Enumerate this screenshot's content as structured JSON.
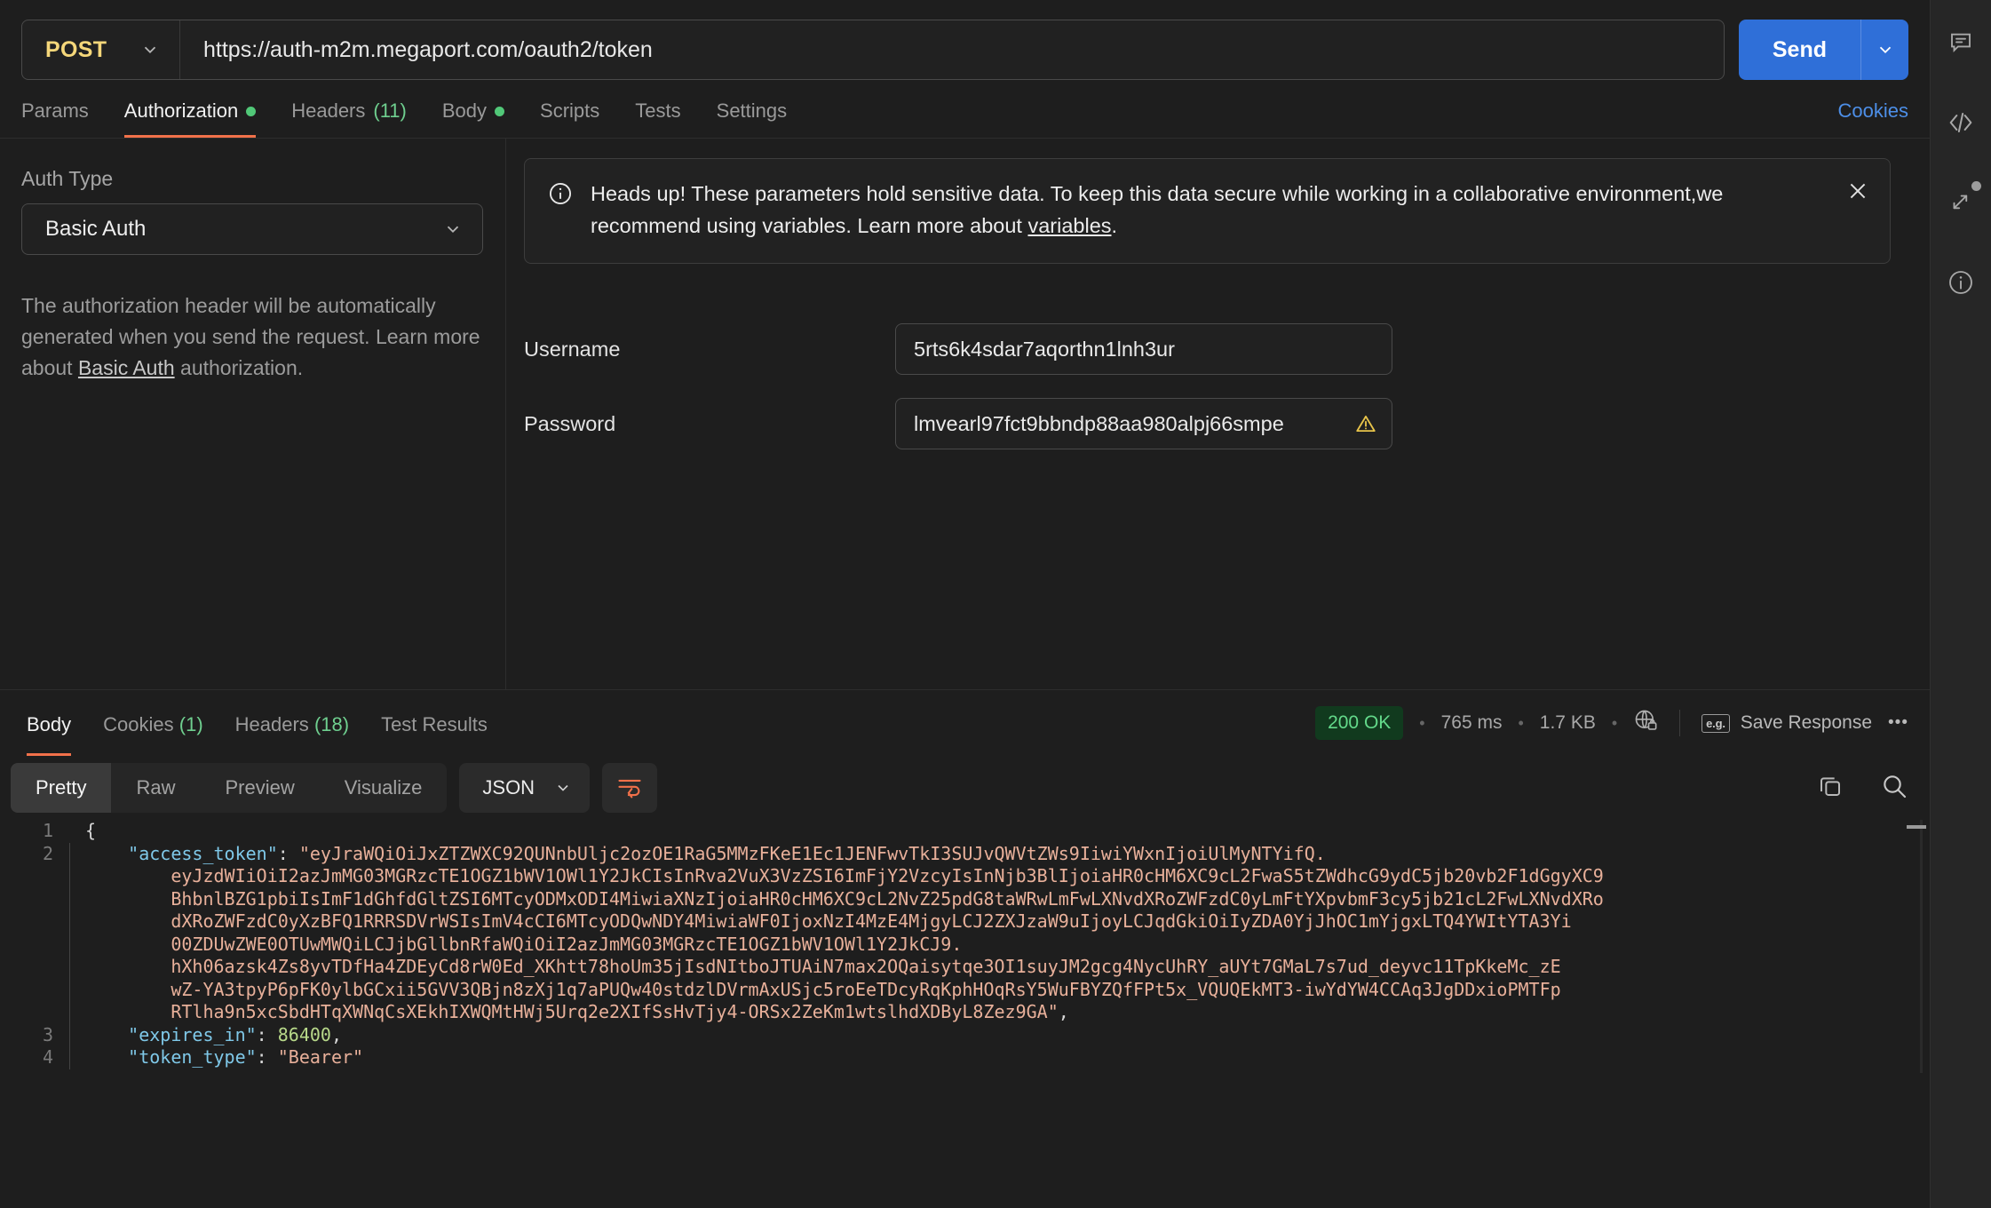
{
  "request": {
    "method": "POST",
    "url": "https://auth-m2m.megaport.com/oauth2/token",
    "send_label": "Send",
    "cookies_label": "Cookies",
    "tabs": [
      {
        "label": "Params",
        "badge": "",
        "dot": false
      },
      {
        "label": "Authorization",
        "badge": "",
        "dot": true
      },
      {
        "label": "Headers",
        "badge": "(11)",
        "dot": false
      },
      {
        "label": "Body",
        "badge": "",
        "dot": true
      },
      {
        "label": "Scripts",
        "badge": "",
        "dot": false
      },
      {
        "label": "Tests",
        "badge": "",
        "dot": false
      },
      {
        "label": "Settings",
        "badge": "",
        "dot": false
      }
    ]
  },
  "auth": {
    "type_label": "Auth Type",
    "type_value": "Basic Auth",
    "help_text_1": "The authorization header will be automatically generated when you send the request. Learn more about ",
    "help_link": "Basic Auth",
    "help_text_2": " authorization.",
    "notice_text_1": "Heads up! These parameters hold sensitive data. To keep this data secure while working in a collaborative environment,we recommend using variables. Learn more about ",
    "notice_link": "variables",
    "notice_text_2": ".",
    "username_label": "Username",
    "username_value": "5rts6k4sdar7aqorthn1lnh3ur",
    "username_placeholder": "Username",
    "password_label": "Password",
    "password_value": "lmvearl97fct9bbndp88aa980alpj66smpe",
    "password_placeholder": "Password"
  },
  "response": {
    "tabs": [
      {
        "label": "Body",
        "badge": ""
      },
      {
        "label": "Cookies",
        "badge": "(1)"
      },
      {
        "label": "Headers",
        "badge": "(18)"
      },
      {
        "label": "Test Results",
        "badge": ""
      }
    ],
    "status": "200 OK",
    "time": "765 ms",
    "size": "1.7 KB",
    "save_label": "Save Response",
    "kebab": "•••",
    "format_tabs": [
      "Pretty",
      "Raw",
      "Preview",
      "Visualize"
    ],
    "format_active": "Pretty",
    "language": "JSON"
  },
  "body_json": {
    "lines": [
      {
        "no": "1",
        "segments": [
          {
            "t": "{",
            "c": "p"
          }
        ]
      },
      {
        "no": "2",
        "segments": [
          {
            "t": "    ",
            "c": "p"
          },
          {
            "t": "\"access_token\"",
            "c": "k"
          },
          {
            "t": ": ",
            "c": "p"
          },
          {
            "t": "\"eyJraWQiOiJxZTZWXC92QUNnbUljc2ozOE1RaG5MMzFKeE1Ec1JENFwvTkI3SUJvQWVtZWs9IiwiYWxnIjoiUlMyNTYifQ.",
            "c": "s"
          }
        ]
      },
      {
        "no": "",
        "segments": [
          {
            "t": "        ",
            "c": "p"
          },
          {
            "t": "eyJzdWIiOiI2azJmMG03MGRzcTE1OGZ1bWV1OWl1Y2JkCIsInRva2VuX3VzZSI6ImFjY2VzcyIsInNjb3BlIjoiaHR0cHM6XC9cL2FwaS5tZWdhcG9ydC5jb20vb2F1dGgyXC9",
            "c": "s"
          }
        ]
      },
      {
        "no": "",
        "segments": [
          {
            "t": "        ",
            "c": "p"
          },
          {
            "t": "BhbnlBZG1pbiIsImF1dGhfdGltZSI6MTcyODMxODI4MiwiaXNzIjoiaHR0cHM6XC9cL2NvZ25pdG8taWRwLmFwLXNvdXRoZWFzdC0yLmFtYXpvbmF3cy5jb21cL2FwLXNvdXRo",
            "c": "s"
          }
        ]
      },
      {
        "no": "",
        "segments": [
          {
            "t": "        ",
            "c": "p"
          },
          {
            "t": "dXRoZWFzdC0yXzBFQ1RRRSDVrWSIsImV4cCI6MTcyODQwNDY4MiwiaWF0IjoxNzI4MzE4MjgyLCJ2ZXJzaW9uIjoyLCJqdGkiOiIyZDA0YjJhOC1mYjgxLTQ4YWItYTA3Yi",
            "c": "s"
          }
        ]
      },
      {
        "no": "",
        "segments": [
          {
            "t": "        ",
            "c": "p"
          },
          {
            "t": "00ZDUwZWE0OTUwMWQiLCJjbGllbnRfaWQiOiI2azJmMG03MGRzcTE1OGZ1bWV1OWl1Y2JkCJ9.",
            "c": "s"
          }
        ]
      },
      {
        "no": "",
        "segments": [
          {
            "t": "        ",
            "c": "p"
          },
          {
            "t": "hXh06azsk4Zs8yvTDfHa4ZDEyCd8rW0Ed_XKhtt78hoUm35jIsdNItboJTUAiN7max2OQaisytqe3OI1suyJM2gcg4NycUhRY_aUYt7GMaL7s7ud_deyvc11TpKkeMc_zE",
            "c": "s"
          }
        ]
      },
      {
        "no": "",
        "segments": [
          {
            "t": "        ",
            "c": "p"
          },
          {
            "t": "wZ-YA3tpyP6pFK0ylbGCxii5GVV3QBjn8zXj1q7aPUQw40stdzlDVrmAxUSjc5roEeTDcyRqKphHOqRsY5WuFBYZQfFPt5x_VQUQEkMT3-iwYdYW4CCAq3JgDDxioPMTFp",
            "c": "s"
          }
        ]
      },
      {
        "no": "",
        "segments": [
          {
            "t": "        ",
            "c": "p"
          },
          {
            "t": "RTlha9n5xcSbdHTqXWNqCsXEkhIXWQMtHWj5Urq2e2XIfSsHvTjy4-ORSx2ZeKm1wtslhdXDByL8Zez9GA\"",
            "c": "s"
          },
          {
            "t": ",",
            "c": "p"
          }
        ]
      },
      {
        "no": "3",
        "segments": [
          {
            "t": "    ",
            "c": "p"
          },
          {
            "t": "\"expires_in\"",
            "c": "k"
          },
          {
            "t": ": ",
            "c": "p"
          },
          {
            "t": "86400",
            "c": "n"
          },
          {
            "t": ",",
            "c": "p"
          }
        ]
      },
      {
        "no": "4",
        "segments": [
          {
            "t": "    ",
            "c": "p"
          },
          {
            "t": "\"token_type\"",
            "c": "k"
          },
          {
            "t": ": ",
            "c": "p"
          },
          {
            "t": "\"Bearer\"",
            "c": "s"
          }
        ]
      }
    ]
  },
  "rail": {
    "items": [
      "comment-icon",
      "code-icon",
      "sync-icon",
      "info-icon"
    ]
  },
  "colors": {
    "accent": "#f2714a",
    "send": "#2f6fd8",
    "link": "#4d8fe8",
    "green": "#51c878",
    "status_bg": "#113a1e",
    "status_fg": "#63d98a",
    "warn": "#e8c44a"
  }
}
